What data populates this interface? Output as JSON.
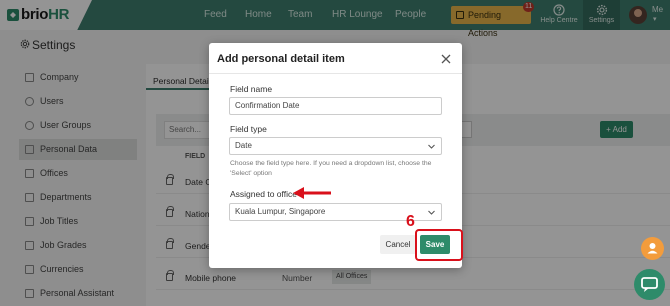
{
  "app": {
    "logo_prefix": "brio",
    "logo_suffix": "HR",
    "nav": [
      "Feed",
      "Home",
      "Team",
      "HR Lounge",
      "People"
    ],
    "pending_actions": {
      "label": "Pending Actions",
      "count": "11"
    },
    "help_centre": "Help Centre",
    "settings": "Settings",
    "me": "Me",
    "brand_color": "#3f7f6f"
  },
  "page": {
    "title": "Settings"
  },
  "sidebar": {
    "items": [
      {
        "label": "Company",
        "icon": "building-icon",
        "active": false
      },
      {
        "label": "Users",
        "icon": "users-icon",
        "active": false
      },
      {
        "label": "User Groups",
        "icon": "user-groups-icon",
        "active": false
      },
      {
        "label": "Personal Data",
        "icon": "personal-data-icon",
        "active": true
      },
      {
        "label": "Offices",
        "icon": "office-icon",
        "active": false
      },
      {
        "label": "Departments",
        "icon": "department-icon",
        "active": false
      },
      {
        "label": "Job Titles",
        "icon": "job-title-icon",
        "active": false
      },
      {
        "label": "Job Grades",
        "icon": "job-grade-icon",
        "active": false
      },
      {
        "label": "Currencies",
        "icon": "currency-icon",
        "active": false
      },
      {
        "label": "Personal Assistant",
        "icon": "assistant-icon",
        "active": false
      }
    ]
  },
  "content": {
    "tab": "Personal Details",
    "search_placeholder": "Search...",
    "add_label": "+ Add",
    "column_field": "FIELD",
    "rows": [
      {
        "name": "Date Of",
        "type": "",
        "office": ""
      },
      {
        "name": "National",
        "type": "",
        "office": ""
      },
      {
        "name": "Gender",
        "type": "",
        "office": ""
      },
      {
        "name": "Mobile phone",
        "type": "Number",
        "office": "All Offices"
      }
    ]
  },
  "modal": {
    "title": "Add personal detail item",
    "field_name_label": "Field name",
    "field_name_value": "Confirmation Date",
    "field_type_label": "Field type",
    "field_type_value": "Date",
    "field_type_help": "Choose the field type here. If you need a dropdown list, choose the 'Select' option",
    "assigned_label": "Assigned to office",
    "assigned_value": "Kuala Lumpur, Singapore",
    "cancel_label": "Cancel",
    "save_label": "Save"
  },
  "annotation": {
    "step_number": "6",
    "color": "#d9101b"
  }
}
